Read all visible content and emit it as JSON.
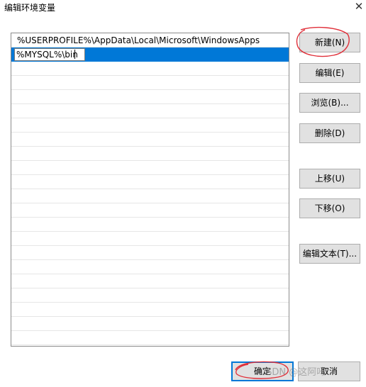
{
  "window": {
    "title": "编辑环境变量",
    "close_glyph": "✕"
  },
  "path_list": {
    "items": [
      "%USERPROFILE%\\AppData\\Local\\Microsoft\\WindowsApps",
      "%MYSQL%\\bin"
    ],
    "editing_value": "%MYSQL%\\bin",
    "selection_color": "#0078d7"
  },
  "buttons": {
    "new": "新建(N)",
    "edit": "编辑(E)",
    "browse": "浏览(B)...",
    "delete": "删除(D)",
    "move_up": "上移(U)",
    "move_down": "下移(O)",
    "edit_text": "编辑文本(T)...",
    "ok": "确定",
    "cancel": "取消"
  },
  "annotation_color": "#e0303a",
  "watermark": "CSDN @这阿咔"
}
